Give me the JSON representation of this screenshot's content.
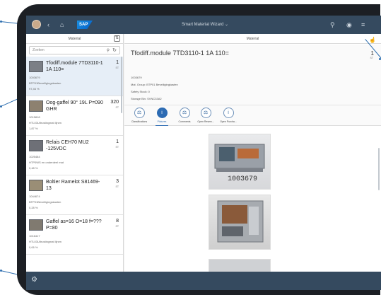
{
  "shell": {
    "title": "Smart Material Wizard",
    "logo_text": "SAP",
    "left_icons": [
      "back-icon",
      "home-icon"
    ],
    "right_icons": [
      "search-icon",
      "notification-icon",
      "menu-icon"
    ]
  },
  "master": {
    "header": "Material",
    "search_placeholder": "Zoeken",
    "items": [
      {
        "name": "Tfodiff.module 7TD3110-1 1A 110=",
        "qty": "1",
        "unit": "ST",
        "id": "1003679",
        "storage": "BTP01Beveiligingskasten",
        "percent": "97,46 %"
      },
      {
        "name": "Oog-gaffel 90° 19L P=090 GHR",
        "qty": "320",
        "unit": "ST",
        "id": "1015818",
        "storage": "HTL03Uitrustingmat lijnen",
        "percent": "1,87 %"
      },
      {
        "name": "Relais CEH70 MU2 -125VDC",
        "qty": "1",
        "unit": "ST",
        "id": "1025484",
        "storage": "HTP0WS en onderdeel mat",
        "percent": "0,48 %"
      },
      {
        "name": "Boltier Ramelot S81469-13",
        "qty": "3",
        "unit": "ST",
        "id": "1044674",
        "storage": "BTP01Beveiligingskasten",
        "percent": "0,28 %"
      },
      {
        "name": "Gaffel as=16 O=18 f=??? P=80",
        "qty": "8",
        "unit": "ST",
        "id": "1016417",
        "storage": "HTL03Uitrustingmat lijnen",
        "percent": "0,06 %"
      }
    ]
  },
  "detail": {
    "header": "Material",
    "title": "Tfodiff.module 7TD3110-1 1A 110=",
    "qty": "1",
    "unit": "ST",
    "attributes": [
      "1003679",
      "Mat. Group: BTP01 Beveiligingkasten",
      "Safety Stock: 0",
      "Storage Bin: SVNC33A2"
    ],
    "tabs": [
      {
        "label": "Classifications",
        "icon": "classification-icon",
        "active": false
      },
      {
        "label": "Pictures",
        "icon": "info-icon",
        "active": true
      },
      {
        "label": "Comments",
        "icon": "comments-icon",
        "active": false
      },
      {
        "label": "Open Reserv...",
        "icon": "reservation-icon",
        "active": false
      },
      {
        "label": "Open Purcha...",
        "icon": "purchase-icon",
        "active": false
      }
    ],
    "picture_label": "1003679"
  },
  "colors": {
    "shell": "#354a5f",
    "accent": "#2c6bb3",
    "selected_row": "#e6eef7"
  }
}
